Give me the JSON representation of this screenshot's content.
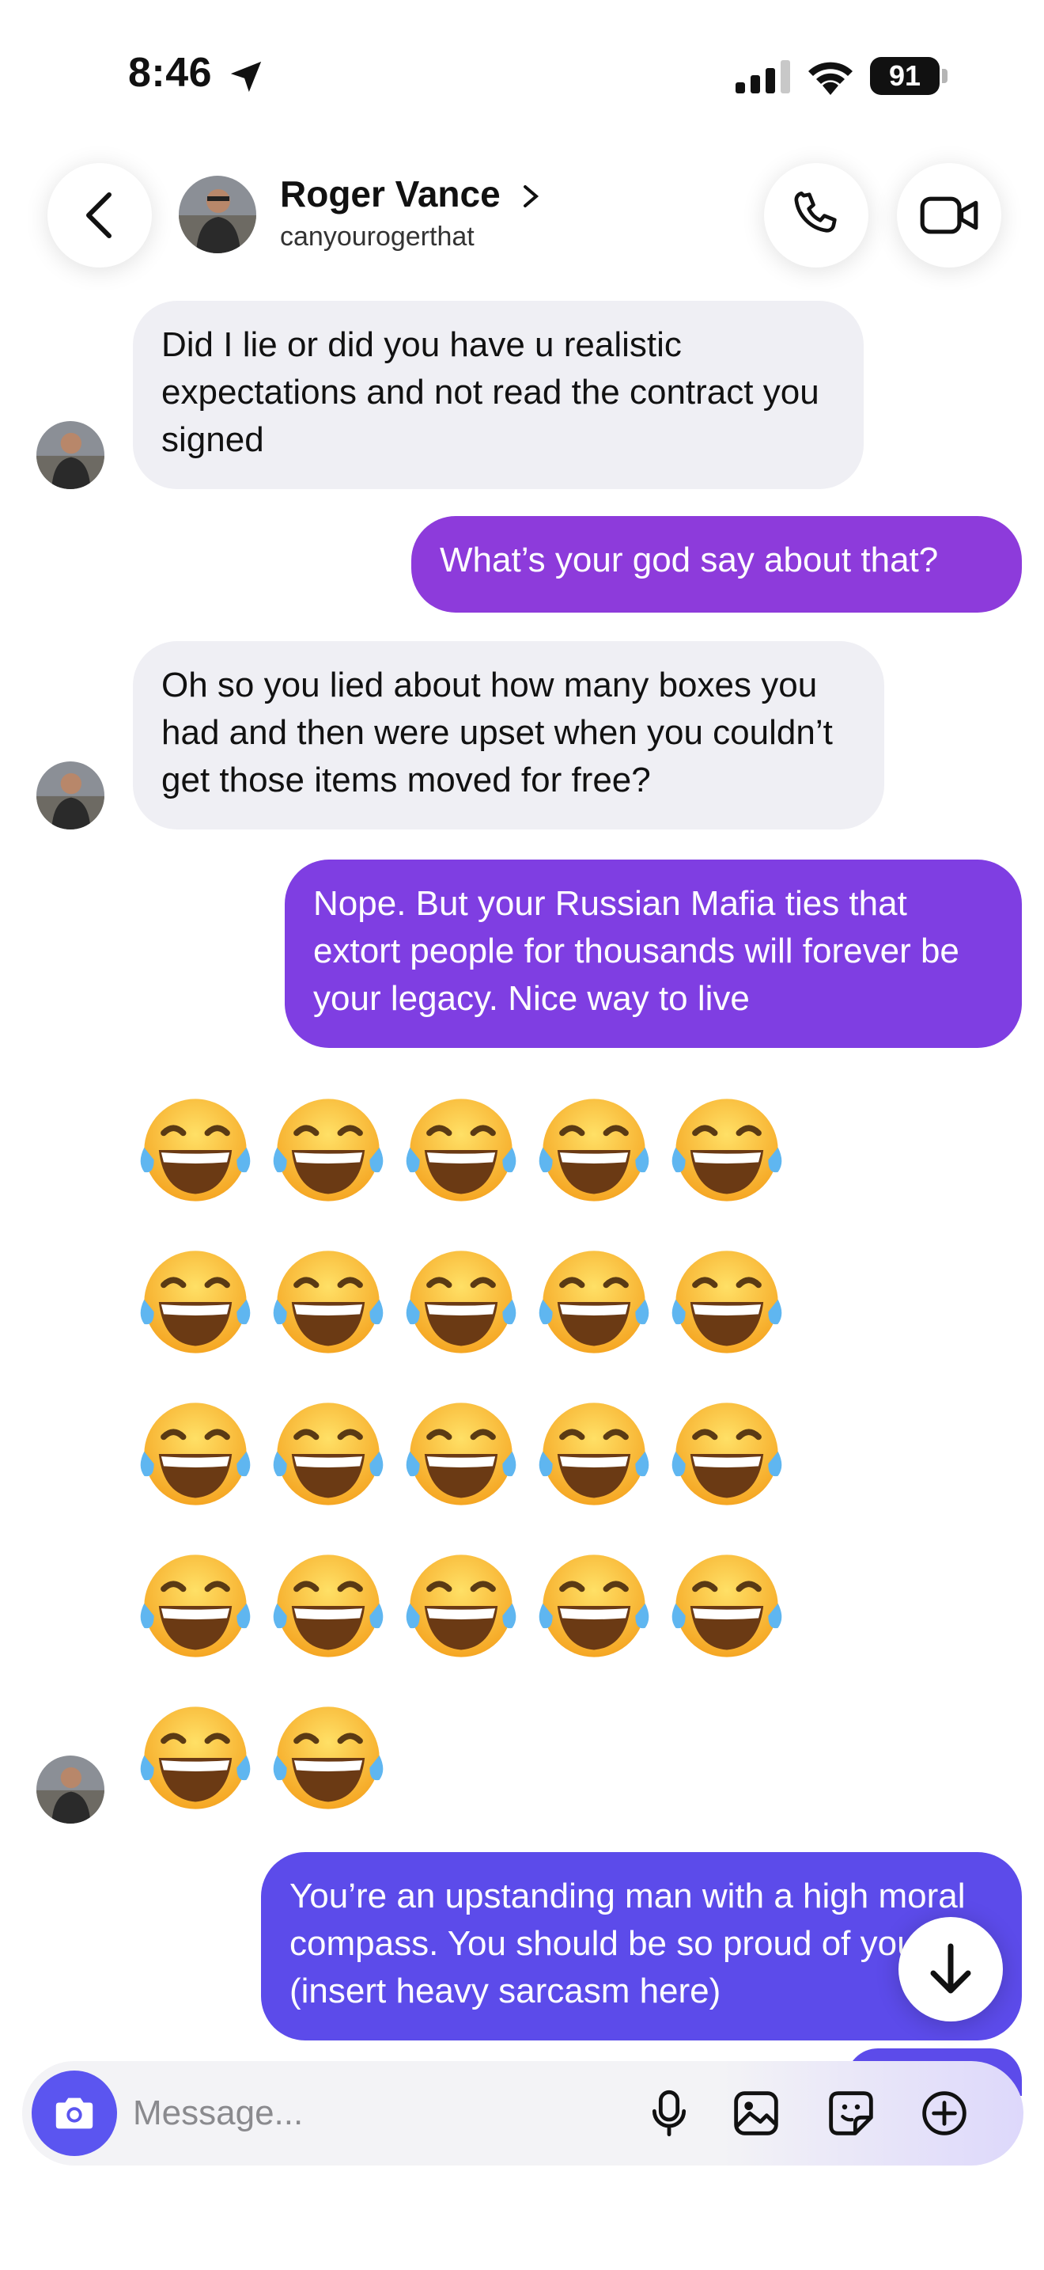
{
  "status_bar": {
    "time": "8:46",
    "battery": "91"
  },
  "header": {
    "name": "Roger Vance",
    "handle": "canyourogerthat"
  },
  "messages": [
    {
      "side": "in",
      "text": "Did I lie or did you have u realistic expectations and not read the contract you signed"
    },
    {
      "side": "out",
      "text": "What’s your god say about that?"
    },
    {
      "side": "in",
      "text": "Oh so you lied about how many boxes you had and then were upset when you couldn’t get those items moved for free?"
    },
    {
      "side": "out",
      "text": "Nope.  But your Russian Mafia ties that extort people for thousands will forever be your legacy.  Nice way to live"
    },
    {
      "side": "in",
      "text": "😂😂😂😂😂😂😂😂😂😂😂😂😂😂😂😂😂😂😂😂😂😂"
    },
    {
      "side": "out",
      "text": "You’re an upstanding man with a high moral compass.  You should be so proud of yourself (insert heavy sarcasm here)"
    }
  ],
  "composer": {
    "placeholder": "Message..."
  },
  "colors": {
    "accent": "#5b55f0",
    "bubble_in": "#efeff4",
    "bubble_out_1": "#8d3bdb",
    "bubble_out_2": "#7f3ee2",
    "bubble_out_3": "#5c4bea"
  },
  "icons": [
    "location-arrow-icon",
    "signal-icon",
    "wifi-icon",
    "back-chevron-icon",
    "phone-icon",
    "video-camera-icon",
    "arrow-down-icon",
    "camera-icon",
    "microphone-icon",
    "gallery-icon",
    "sticker-icon",
    "plus-circle-icon"
  ]
}
